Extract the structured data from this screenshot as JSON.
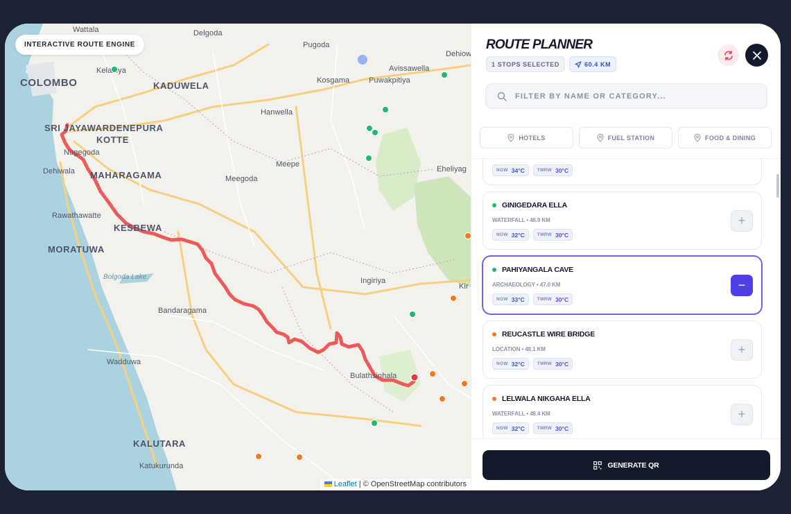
{
  "map": {
    "badge": "INTERACTIVE ROUTE ENGINE",
    "places": {
      "wattala": "Wattala",
      "delgoda": "Delgoda",
      "pugoda": "Pugoda",
      "dehiowita": "Dehiow",
      "kelaniya": "Kelaniya",
      "colombo": "COLOMBO",
      "kaduwela": "KADUWELA",
      "kosgama": "Kosgama",
      "puwakpitiya": "Puwakpitiya",
      "avissawella": "Avissawella",
      "hanwella": "Hanwella",
      "sjk_line1": "SRI JAYAWARDENEPURA",
      "sjk_line2": "KOTTE",
      "nugegoda": "Nugegoda",
      "dehiwala": "Dehiwala",
      "maharagama": "MAHARAGAMA",
      "meepe": "Meepe",
      "meegoda": "Meegoda",
      "eheliyagoda": "Eheliyag",
      "rawathawatte": "Rawathawatte",
      "kesbewa": "KESBEWA",
      "moratuwa": "MORATUWA",
      "bolgoda": "Bolgoda   Lake",
      "ingiriya": "Ingiriya",
      "kiriella": "Kir",
      "bandaragama": "Bandaragama",
      "wadduwa": "Wadduwa",
      "bulathsinhala": "Bulathsinhala",
      "kalutara": "KALUTARA",
      "katukurunda": "Katukurunda"
    },
    "attribution_link": "Leaflet",
    "attribution_text": " | © OpenStreetMap contributors",
    "colors": {
      "route": "#ec5a5a",
      "marker_green": "#1fb86f",
      "marker_orange": "#f07a22",
      "marker_end": "#e2373f",
      "marker_blue": "#97b2ee"
    }
  },
  "panel": {
    "title": "ROUTE PLANNER",
    "stops_chip": "1 STOPS SELECTED",
    "distance_chip": "60.4 KM",
    "search_placeholder": "FILTER BY NAME OR CATEGORY...",
    "categories": [
      "HOTELS",
      "FUEL STATION",
      "FOOD & DINING"
    ],
    "items": [
      {
        "name": "",
        "meta": "",
        "now": "34°C",
        "tmrw": "30°C",
        "dot": "#1fb86f",
        "selected": false
      },
      {
        "name": "GINIGEDARA ELLA",
        "meta": "WATERFALL • 46.9 KM",
        "now": "32°C",
        "tmrw": "30°C",
        "dot": "#1fb86f",
        "selected": false
      },
      {
        "name": "PAHIYANGALA CAVE",
        "meta": "ARCHAEOLOGY • 47.0 KM",
        "now": "33°C",
        "tmrw": "30°C",
        "dot": "#1fb86f",
        "selected": true
      },
      {
        "name": "REUCASTLE WIRE BRIDGE",
        "meta": "LOCATION • 48.1 KM",
        "now": "32°C",
        "tmrw": "30°C",
        "dot": "#f07a22",
        "selected": false
      },
      {
        "name": "LELWALA NIKGAHA ELLA",
        "meta": "WATERFALL • 48.4 KM",
        "now": "32°C",
        "tmrw": "30°C",
        "dot": "#f07a22",
        "selected": false
      }
    ],
    "now_label": "NOW",
    "tmrw_label": "TMRW",
    "add_symbol": "+",
    "remove_symbol": "−",
    "generate_label": "GENERATE QR"
  }
}
